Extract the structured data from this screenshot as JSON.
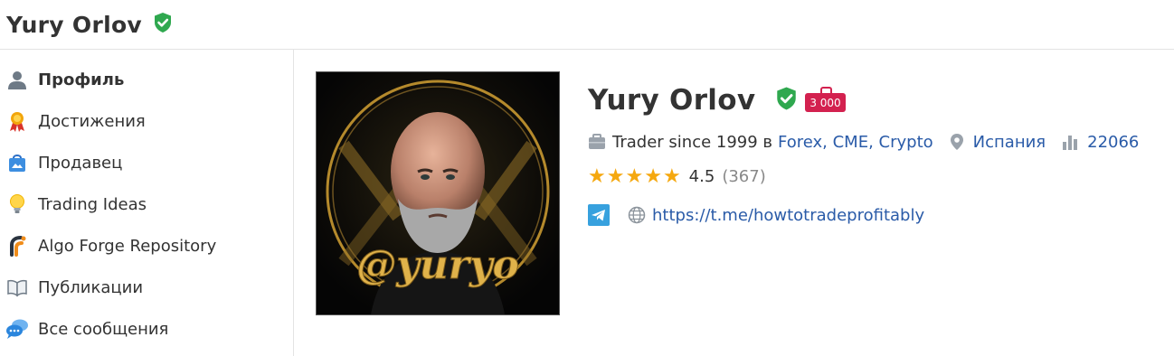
{
  "header": {
    "title": "Yury Orlov"
  },
  "sidebar": {
    "items": [
      {
        "label": "Профиль"
      },
      {
        "label": "Достижения"
      },
      {
        "label": "Продавец"
      },
      {
        "label": "Trading Ideas"
      },
      {
        "label": "Algo Forge Repository"
      },
      {
        "label": "Публикации"
      },
      {
        "label": "Все сообщения"
      }
    ]
  },
  "avatar": {
    "overlay_text": "@yuryo"
  },
  "profile": {
    "name": "Yury Orlov",
    "badge": "3 000",
    "trader_since": "Trader since 1999 в",
    "markets": "Forex, CME, Crypto",
    "country": "Испания",
    "views": "22066",
    "rating": "4.5",
    "reviews": "(367)",
    "website": "https://t.me/howtotradeprofitably"
  },
  "colors": {
    "accent_link": "#2a5ba8",
    "verified": "#2fa84f",
    "badge": "#d3214f",
    "stars": "#f5a80f"
  }
}
